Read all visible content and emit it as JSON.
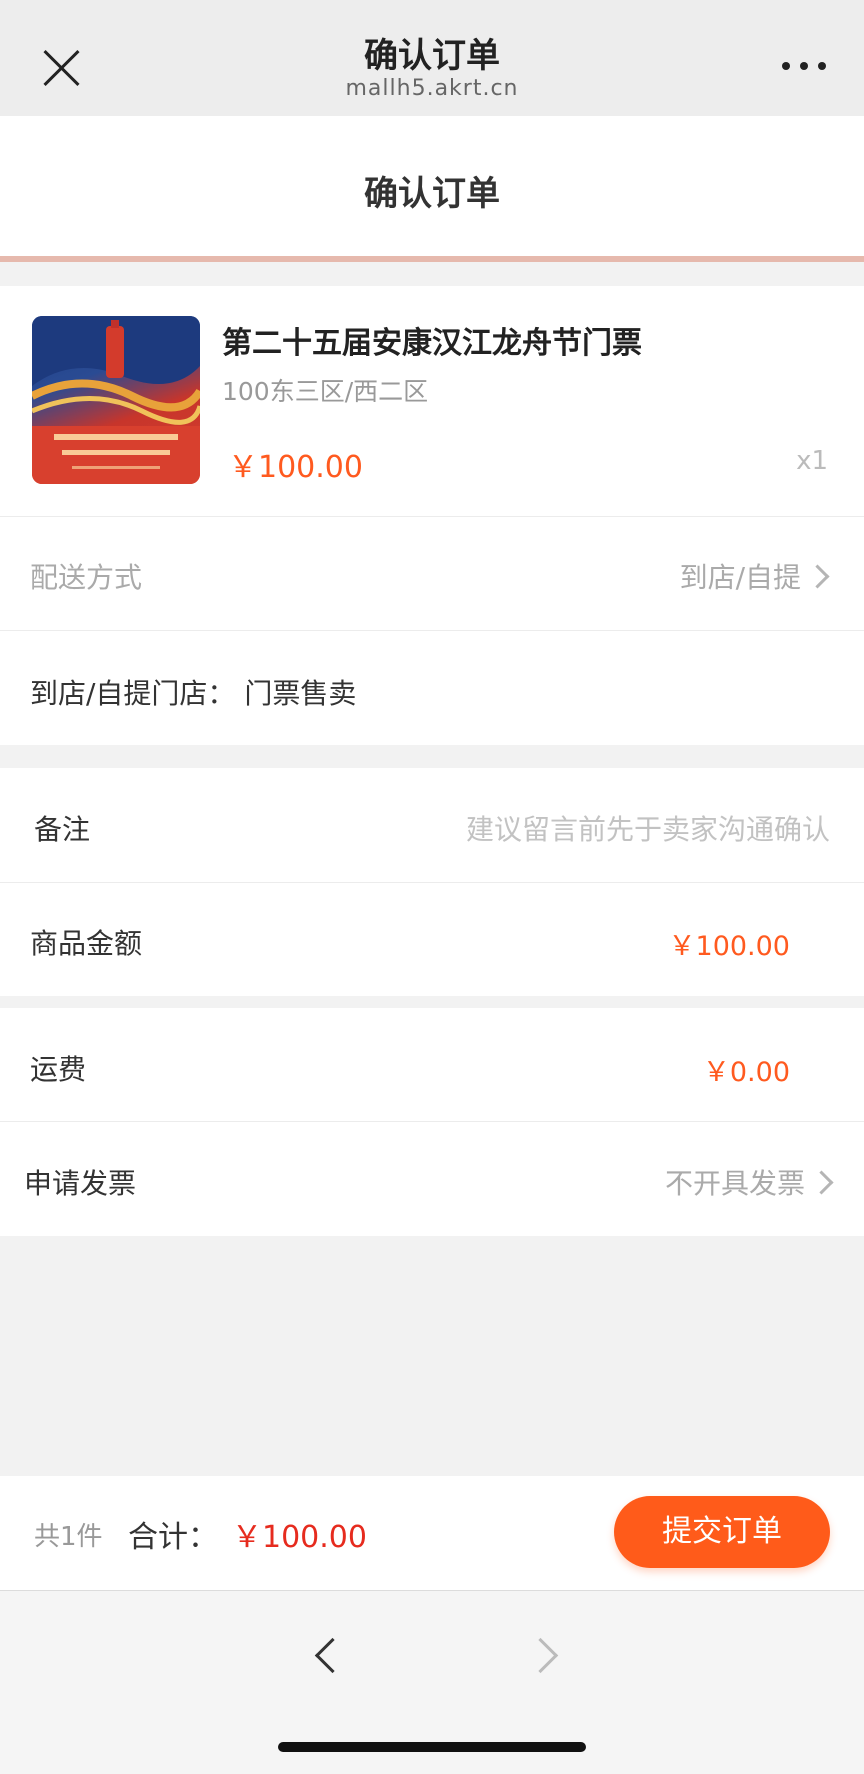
{
  "browser": {
    "title": "确认订单",
    "url": "mallh5.akrt.cn"
  },
  "page": {
    "title": "确认订单"
  },
  "product": {
    "name": "第二十五届安康汉江龙舟节门票",
    "spec": "100东三区/西二区",
    "price": "￥100.00",
    "quantity": "x1"
  },
  "delivery": {
    "label": "配送方式",
    "value": "到店/自提"
  },
  "store": {
    "label": "到店/自提门店：",
    "value": "门票售卖"
  },
  "remark": {
    "label": "备注",
    "placeholder": "建议留言前先于卖家沟通确认"
  },
  "amount": {
    "label": "商品金额",
    "value": "￥100.00"
  },
  "shipping": {
    "label": "运费",
    "value": "￥0.00"
  },
  "invoice": {
    "label": "申请发票",
    "value": "不开具发票"
  },
  "footer": {
    "count": "共1件",
    "total_label": "合计：",
    "total_value": "￥100.00",
    "submit_label": "提交订单"
  },
  "colors": {
    "accent": "#ff5b1a",
    "total_red": "#e62b1e"
  }
}
